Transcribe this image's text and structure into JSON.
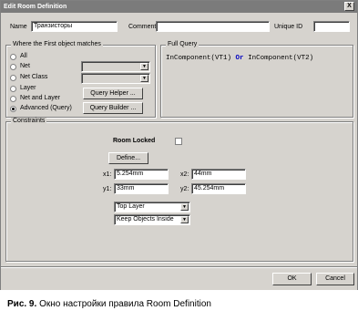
{
  "window": {
    "title": "Edit Room Definition",
    "close_glyph": "X"
  },
  "top": {
    "name_label": "Name",
    "name_value": "Транзисторы",
    "comment_label": "Comment",
    "comment_value": "",
    "unique_label": "Unique ID",
    "unique_value": ""
  },
  "match": {
    "title": "Where the First object matches",
    "options": [
      "All",
      "Net",
      "Net Class",
      "Layer",
      "Net and Layer",
      "Advanced (Query)"
    ],
    "selected": "Advanced (Query)",
    "query_helper": "Query Helper ...",
    "query_builder": "Query Builder ..."
  },
  "query": {
    "title": "Full Query",
    "parts": [
      "InComponent(VT1)",
      "Or",
      "InComponent(VT2)"
    ],
    "keyword_color": "#0000c0"
  },
  "constraints": {
    "title": "Constraints",
    "room_locked_label": "Room Locked",
    "room_locked": false,
    "define_label": "Define...",
    "x1_label": "x1:",
    "x1": "5.254mm",
    "y1_label": "y1:",
    "y1": "33mm",
    "x2_label": "x2:",
    "x2": "44mm",
    "y2_label": "y2:",
    "y2": "45.254mm",
    "layer": "Top Layer",
    "keep": "Keep Objects Inside"
  },
  "footer": {
    "ok": "OK",
    "cancel": "Cancel"
  },
  "caption": {
    "prefix": "Рис. 9.",
    "text": "Окно настройки правила Room Definition"
  }
}
